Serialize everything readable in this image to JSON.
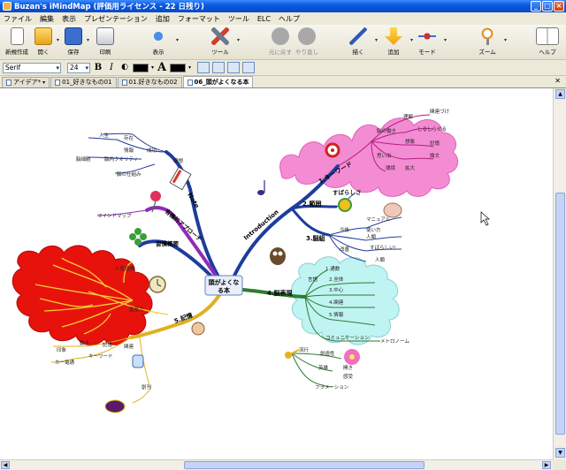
{
  "window": {
    "title": "Buzan's iMindMap (評価用ライセンス - 22 日残り)",
    "minimize_glyph": "_",
    "maximize_glyph": "□",
    "close_glyph": "×"
  },
  "menu": [
    "ファイル",
    "編集",
    "表示",
    "プレゼンテーション",
    "追加",
    "フォーマット",
    "ツール",
    "ELC",
    "ヘルプ"
  ],
  "toolbar": {
    "new": "新規作成",
    "open": "開く",
    "save": "保存",
    "print": "印刷",
    "view": "表示",
    "tools": "ツール",
    "undo": "元に戻す",
    "redo": "やり直し",
    "draw": "描く",
    "add": "追加",
    "mode": "モード",
    "zoom": "ズーム",
    "help": "ヘルプ"
  },
  "format": {
    "font": "Serif",
    "size": "24",
    "bold": "B",
    "italic": "I",
    "text_color_glyph": "A"
  },
  "tabs": [
    "アイデア*",
    "01_好きなもの01",
    "01.好きなもの02",
    "06_頭がよくなる本"
  ],
  "colors": {
    "accent": "#0A5BE0",
    "red_cloud": "#E8120C",
    "pink_cloud": "#F48CD4",
    "cyan_cloud": "#BFF4F2",
    "branch_blue": "#1E3C9C",
    "branch_purple": "#8E2CB8",
    "branch_green": "#2E7D32",
    "branch_gold": "#E0B020"
  },
  "mindmap": {
    "central": [
      "頭がよくな",
      "る本"
    ],
    "main_branches": {
      "note": "Note",
      "intro": "Introduction",
      "keyword": "1.キーワード",
      "rhythm": "2.範囲",
      "brain": "3.脳組",
      "memory": "4.脳表現",
      "recall": "5.記憶",
      "meta": "有機的アプローチ",
      "habit": "習慣概要"
    },
    "labels": {
      "a1": "人生",
      "a2": "存在",
      "a3": "成功",
      "a4": "構想",
      "a5": "脳内クオリティ",
      "a6": "情報",
      "a7": "脳細胞",
      "a8": "脳の仕組み",
      "a9": "マインドマップ",
      "b1": "学習",
      "b2": "経験",
      "b3": "習慣",
      "c1": "すばらしさ",
      "c2": "マニュアル",
      "c3": "使い方",
      "c4": "人類",
      "c5": "すばらしい!",
      "c6": "今後",
      "c7": "改善",
      "c8": "人類",
      "d1": "言語",
      "d2": "1.通数",
      "d3": "2.全体",
      "d4": "3.中心",
      "d5": "4.関連",
      "d6": "5.情報",
      "d7": "コミュニケーション",
      "d8": "メトロノーム",
      "d9": "流行",
      "d10": "創造性",
      "d11": "英雄",
      "d12": "開き",
      "d13": "感受",
      "d14": "フラメーション",
      "e1": "記憶",
      "e2": "動き",
      "e3": "キーワード",
      "e4": "印象",
      "e5": "カー電通",
      "e6": "関連",
      "e7": "創刊",
      "f1": "人気感情",
      "f2": "直感力",
      "f3": "理解",
      "f4": "関連づけ",
      "f5": "しるしらせる",
      "f6": "想像",
      "f7": "記憶",
      "f8": "思い出",
      "f9": "論文",
      "f10": "環境",
      "f11": "拡大",
      "f12": "脳の働き"
    }
  }
}
